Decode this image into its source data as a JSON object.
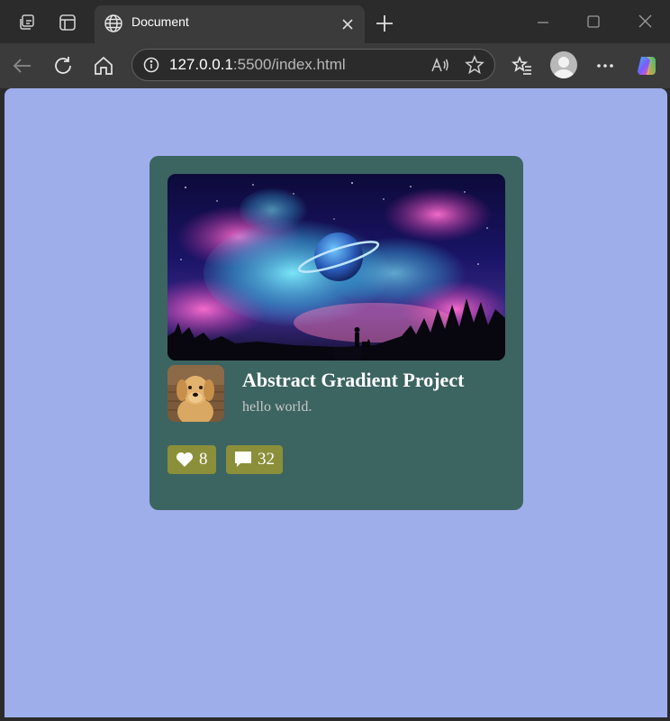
{
  "browser": {
    "tab_title": "Document",
    "address": {
      "host": "127.0.0.1",
      "rest": ":5500/index.html"
    }
  },
  "card": {
    "title": "Abstract Gradient Project",
    "subtitle": "hello world.",
    "likes": "8",
    "comments": "32"
  },
  "icons": {
    "workspaces": "workspaces-icon",
    "tab_actions": "tab-actions-icon",
    "globe": "globe-icon",
    "close": "close-icon",
    "new_tab": "plus-icon",
    "back": "back-arrow-icon",
    "reload": "reload-icon",
    "home": "home-icon",
    "info": "info-icon",
    "read_aloud": "read-aloud-icon",
    "favorite": "star-icon",
    "favorites": "favorites-icon",
    "profile": "profile-icon",
    "more": "more-icon",
    "copilot": "copilot-icon",
    "heart": "heart-icon",
    "comment": "comment-icon"
  },
  "colors": {
    "page_background": "#9eaeea",
    "card_background": "#3c6461",
    "stat_badge": "#8b8f3a",
    "browser_frame": "#2b2b2b",
    "browser_toolbar": "#3b3b3b"
  }
}
